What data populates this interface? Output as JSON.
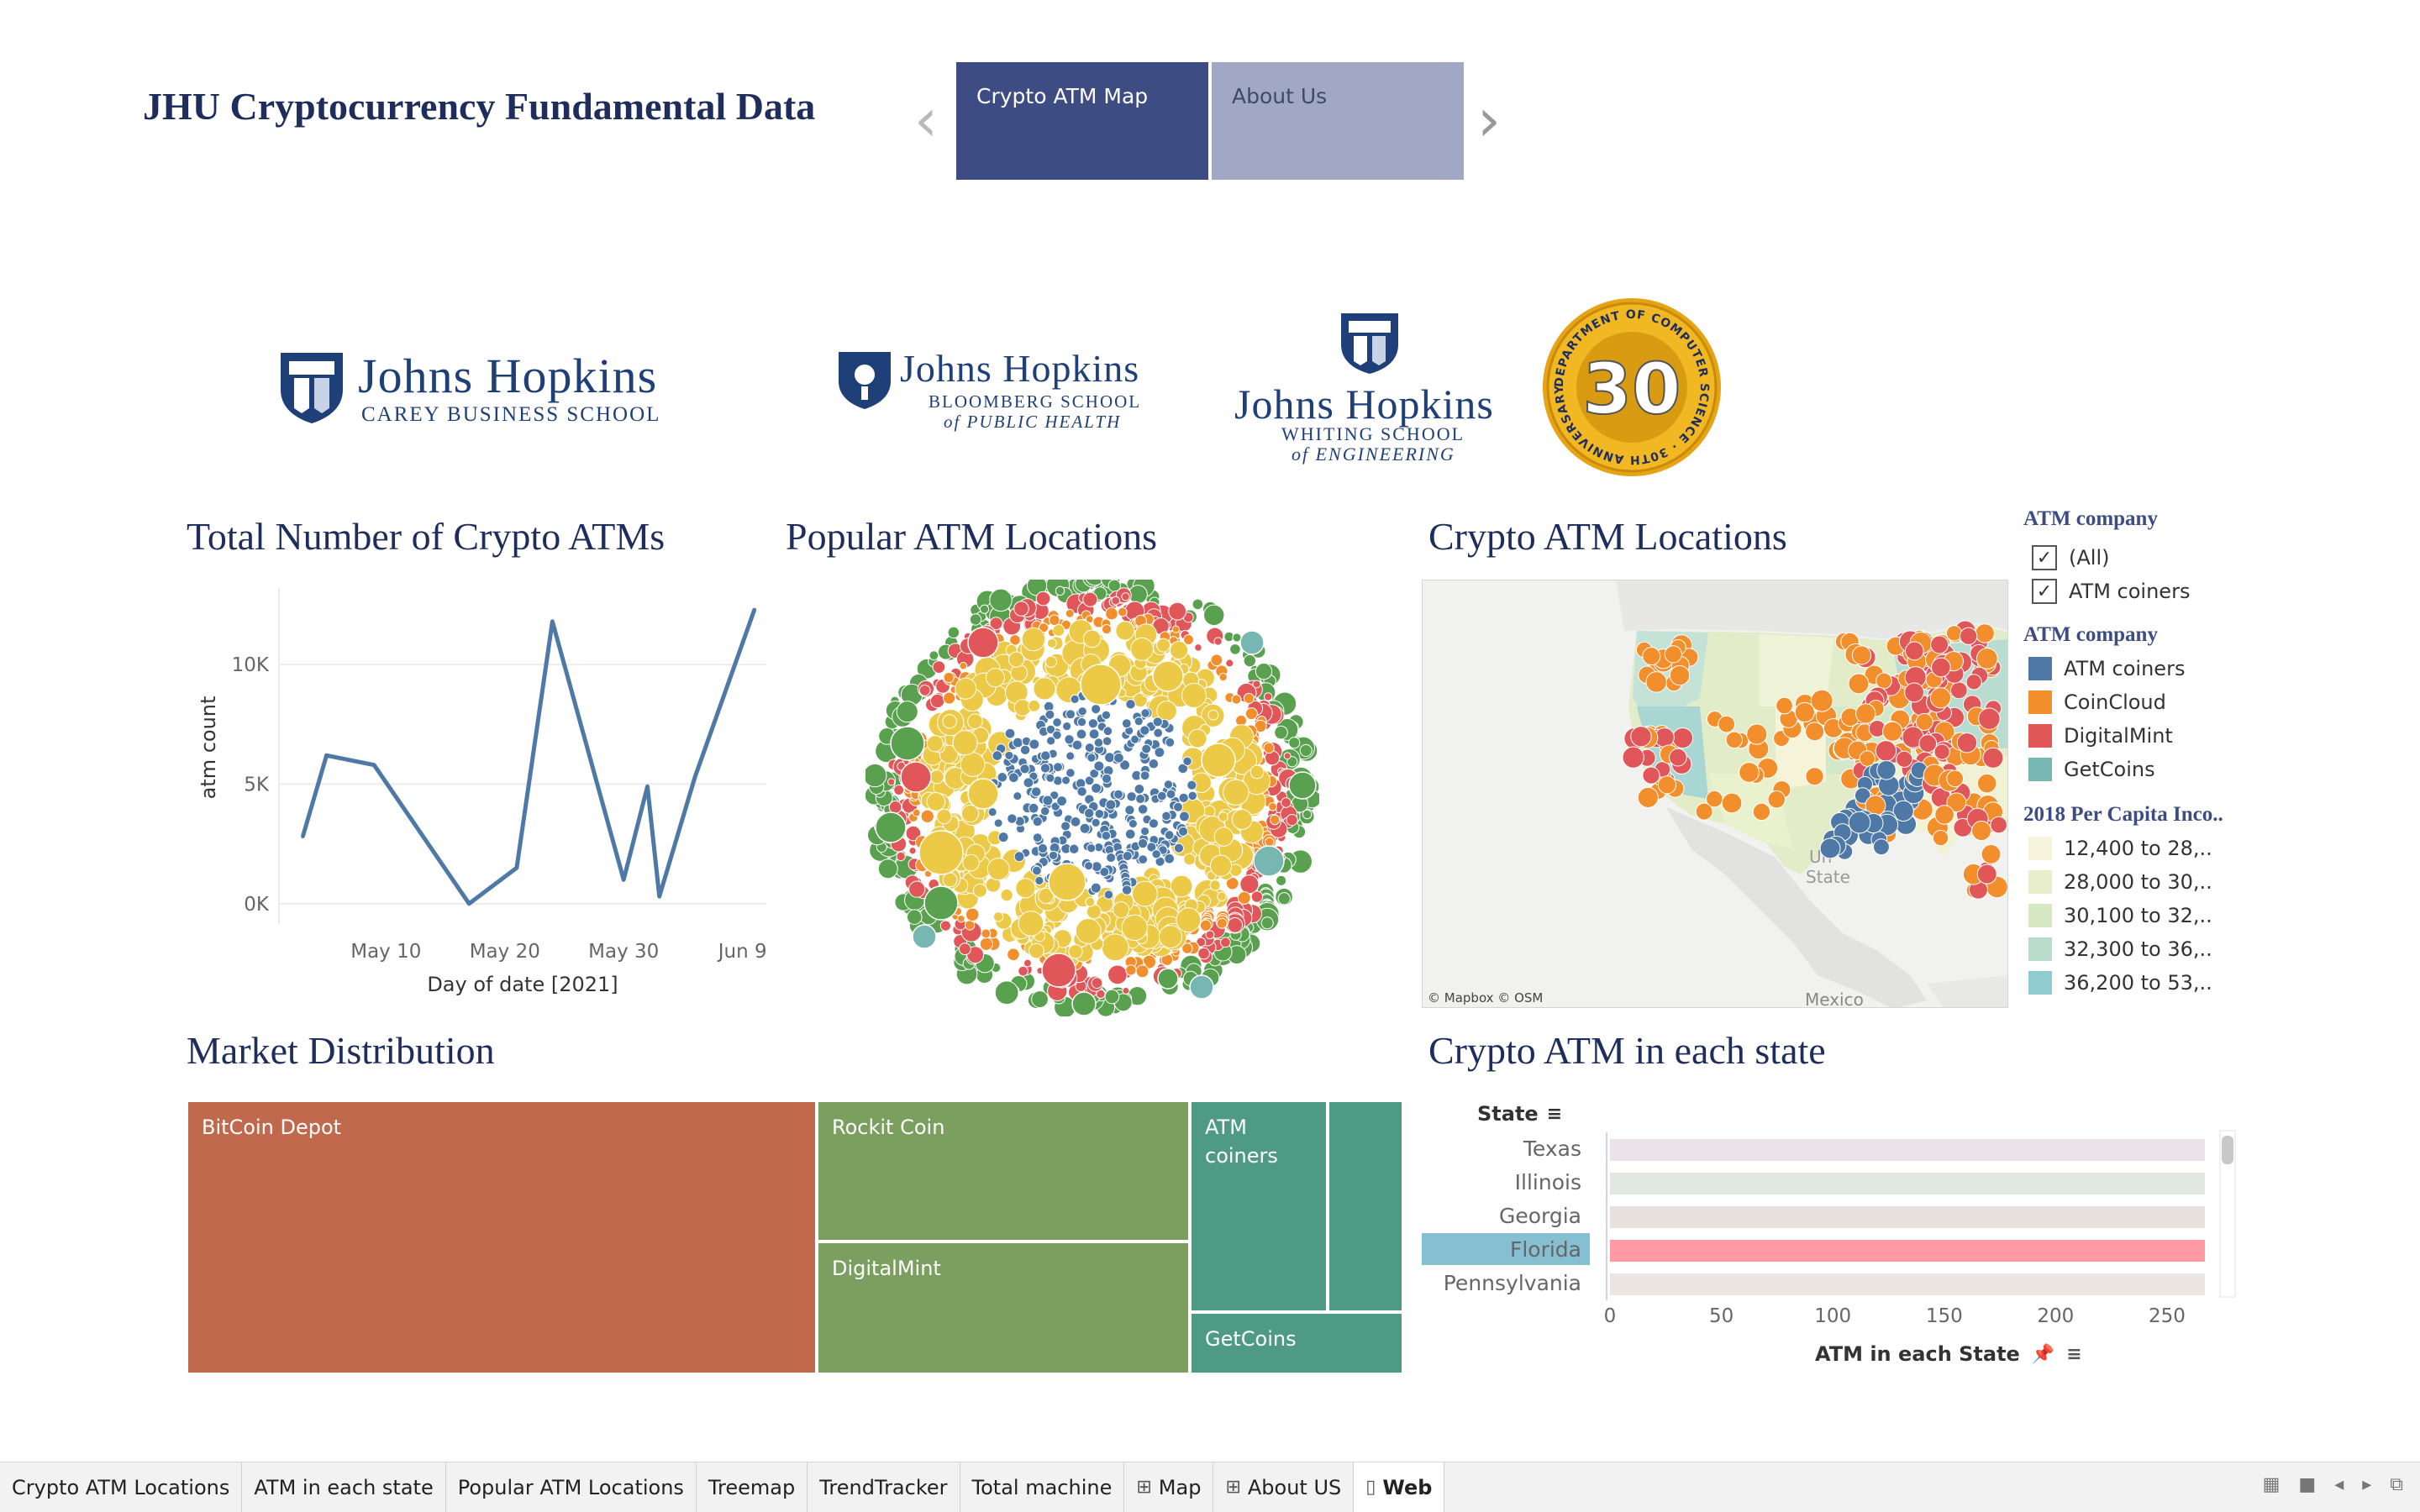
{
  "header": {
    "title": "JHU Cryptocurrency Fundamental Data",
    "prev_icon": "chevron-left-icon",
    "next_icon": "chevron-right-icon",
    "tabs": [
      {
        "label": "Crypto ATM Map",
        "active": true
      },
      {
        "label": "About Us",
        "active": false
      }
    ]
  },
  "logos": {
    "carey": {
      "name": "Johns Hopkins",
      "sub": "CAREY BUSINESS SCHOOL"
    },
    "bloomberg": {
      "name": "Johns Hopkins",
      "sub1": "BLOOMBERG SCHOOL",
      "sub2": "of PUBLIC HEALTH"
    },
    "whiting": {
      "name": "Johns Hopkins",
      "sub1": "WHITING SCHOOL",
      "sub2": "of ENGINEERING"
    },
    "seal": {
      "number": "30",
      "ring_text": "DEPARTMENT OF COMPUTER SCIENCE · 30TH ANNIVERSARY ·"
    }
  },
  "line_chart": {
    "title": "Total Number of Crypto ATMs",
    "chart_data": {
      "type": "line",
      "title": "Total Number of Crypto ATMs",
      "xlabel": "Day of date [2021]",
      "ylabel": "atm count",
      "x_ticks": [
        "May 10",
        "May 20",
        "May 30",
        "Jun 9"
      ],
      "y_ticks": [
        "0K",
        "5K",
        "10K"
      ],
      "ylim": [
        -500,
        13200
      ],
      "xlim_days": [
        "May 1",
        "Jun 11"
      ],
      "color": "#4e79a7",
      "points": [
        {
          "x": "May 3",
          "y": 2800
        },
        {
          "x": "May 5",
          "y": 6200
        },
        {
          "x": "May 9",
          "y": 5800
        },
        {
          "x": "May 17",
          "y": 0
        },
        {
          "x": "May 21",
          "y": 1500
        },
        {
          "x": "May 24",
          "y": 11800
        },
        {
          "x": "May 30",
          "y": 1000
        },
        {
          "x": "Jun 1",
          "y": 4900
        },
        {
          "x": "Jun 2",
          "y": 300
        },
        {
          "x": "Jun 5",
          "y": 5300
        },
        {
          "x": "Jun 10",
          "y": 12300
        }
      ]
    }
  },
  "bubble_chart": {
    "title": "Popular ATM Locations",
    "colors": {
      "atm_coiners": "#4e79a7",
      "coincloud": "#f28e2b",
      "digitalmint": "#e15759",
      "getcoins": "#76b7b2",
      "yellow": "#edc948",
      "green": "#59a14f"
    }
  },
  "map": {
    "title": "Crypto ATM Locations",
    "labels": {
      "state_fragment1": "Un",
      "state_fragment2": "State",
      "mexico": "Mexico"
    },
    "attribution": "© Mapbox © OSM"
  },
  "legend": {
    "filter_title": "ATM company",
    "filter_items": [
      {
        "label": "(All)",
        "checked": true
      },
      {
        "label": "ATM coiners",
        "checked": true
      }
    ],
    "color_title": "ATM company",
    "color_items": [
      {
        "label": "ATM coiners",
        "color": "#4e79a7"
      },
      {
        "label": "CoinCloud",
        "color": "#f28e2b"
      },
      {
        "label": "DigitalMint",
        "color": "#e15759"
      },
      {
        "label": "GetCoins",
        "color": "#76b7b2"
      }
    ],
    "income_title": "2018 Per Capita Inco..",
    "income_items": [
      {
        "label": "12,400 to 28,..",
        "color": "#f6f4dc"
      },
      {
        "label": "28,000 to 30,..",
        "color": "#e8eecb"
      },
      {
        "label": "30,100 to 32,..",
        "color": "#d6e8c4"
      },
      {
        "label": "32,300 to 36,..",
        "color": "#b9dccb"
      },
      {
        "label": "36,200 to 53,..",
        "color": "#8fcbd0"
      }
    ]
  },
  "treemap": {
    "title": "Market Distribution",
    "cells": [
      {
        "label": "BitCoin Depot",
        "color": "#c1694d"
      },
      {
        "label": "Rockit Coin",
        "color": "#7a9f5f"
      },
      {
        "label": "DigitalMint",
        "color": "#7a9f5f"
      },
      {
        "label": "ATM coiners",
        "color": "#4f9a82"
      },
      {
        "label": "",
        "color": "#4f9a82"
      },
      {
        "label": "GetCoins",
        "color": "#4f9a82"
      }
    ]
  },
  "bar_chart": {
    "title": "Crypto ATM in each state",
    "state_header": "State",
    "xlabel": "ATM in each State",
    "chart_data": {
      "type": "bar",
      "categories": [
        "Texas",
        "Illinois",
        "Georgia",
        "Florida",
        "Pennsylvania"
      ],
      "values": [
        267,
        267,
        267,
        267,
        267
      ],
      "colors": [
        "#ece3ea",
        "#e1e8e4",
        "#e8e0dc",
        "#ff9aa2",
        "#ece6e3"
      ],
      "highlighted": "Florida",
      "x_ticks": [
        "0",
        "50",
        "100",
        "150",
        "200",
        "250"
      ],
      "xlim": [
        0,
        270
      ],
      "xlabel": "ATM in each State",
      "ylabel": "State"
    }
  },
  "tab_bar": {
    "tabs": [
      {
        "label": "Crypto ATM Locations",
        "icon": "",
        "active": false
      },
      {
        "label": "ATM in each state",
        "icon": "",
        "active": false
      },
      {
        "label": "Popular ATM Locations",
        "icon": "",
        "active": false
      },
      {
        "label": "Treemap",
        "icon": "",
        "active": false
      },
      {
        "label": "TrendTracker",
        "icon": "",
        "active": false
      },
      {
        "label": "Total machine",
        "icon": "",
        "active": false
      },
      {
        "label": "Map",
        "icon": "grid-icon",
        "active": false
      },
      {
        "label": "About US",
        "icon": "grid-icon",
        "active": false
      },
      {
        "label": "Web",
        "icon": "book-icon",
        "active": true
      }
    ]
  }
}
